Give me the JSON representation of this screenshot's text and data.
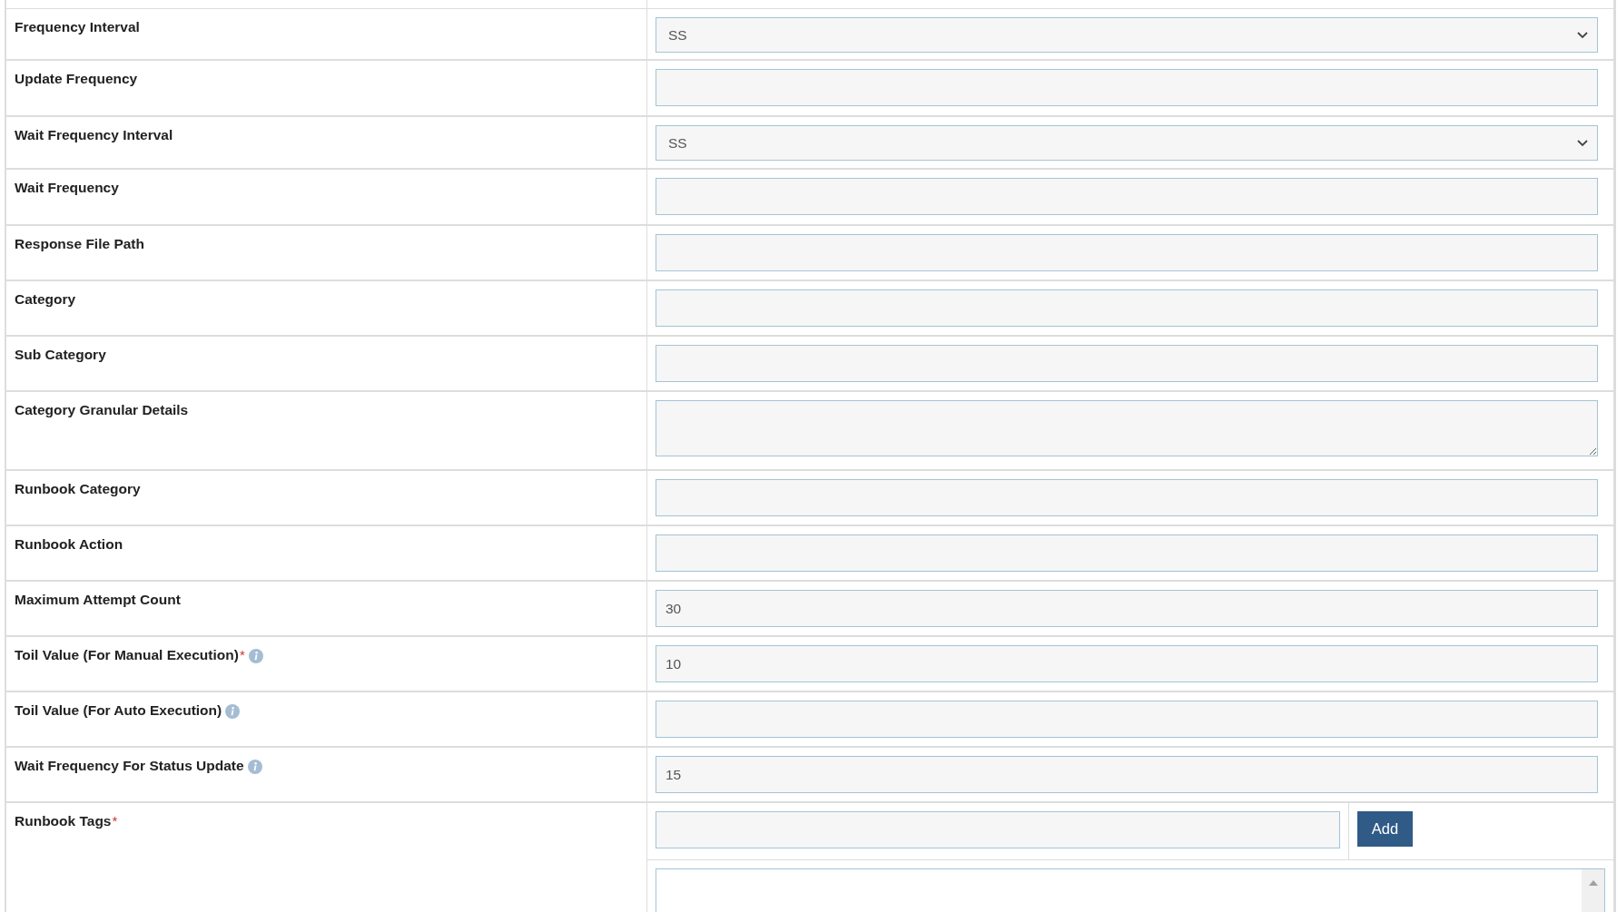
{
  "rows": [
    {
      "label": "Frequency Interval",
      "kind": "select",
      "value": "SS",
      "required": false,
      "info": false
    },
    {
      "label": "Update Frequency",
      "kind": "input",
      "required": false,
      "info": false
    },
    {
      "label": "Wait Frequency Interval",
      "kind": "select",
      "value": "SS",
      "required": false,
      "info": false
    },
    {
      "label": "Wait Frequency",
      "kind": "input",
      "required": false,
      "info": false
    },
    {
      "label": "Response File Path",
      "kind": "input",
      "required": false,
      "info": false
    },
    {
      "label": "Category",
      "kind": "input",
      "required": false,
      "info": false
    },
    {
      "label": "Sub Category",
      "kind": "input",
      "required": false,
      "info": false
    },
    {
      "label": "Category Granular Details",
      "kind": "textarea",
      "required": false,
      "info": false
    },
    {
      "label": "Runbook Category",
      "kind": "input",
      "required": false,
      "info": false
    },
    {
      "label": "Runbook Action",
      "kind": "input",
      "required": false,
      "info": false
    },
    {
      "label": "Maximum Attempt Count",
      "kind": "input",
      "value": "30",
      "required": false,
      "info": false
    },
    {
      "label": "Toil Value (For Manual Execution)",
      "kind": "input",
      "value": "10",
      "required": true,
      "info": true
    },
    {
      "label": "Toil Value (For Auto Execution)",
      "kind": "input",
      "required": false,
      "info": true
    },
    {
      "label": "Wait Frequency For Status Update",
      "kind": "input",
      "value": "15",
      "required": false,
      "info": true
    },
    {
      "label": "Runbook Tags",
      "kind": "tags",
      "button": "Add",
      "required": true,
      "info": false
    }
  ],
  "required_mark": "*"
}
